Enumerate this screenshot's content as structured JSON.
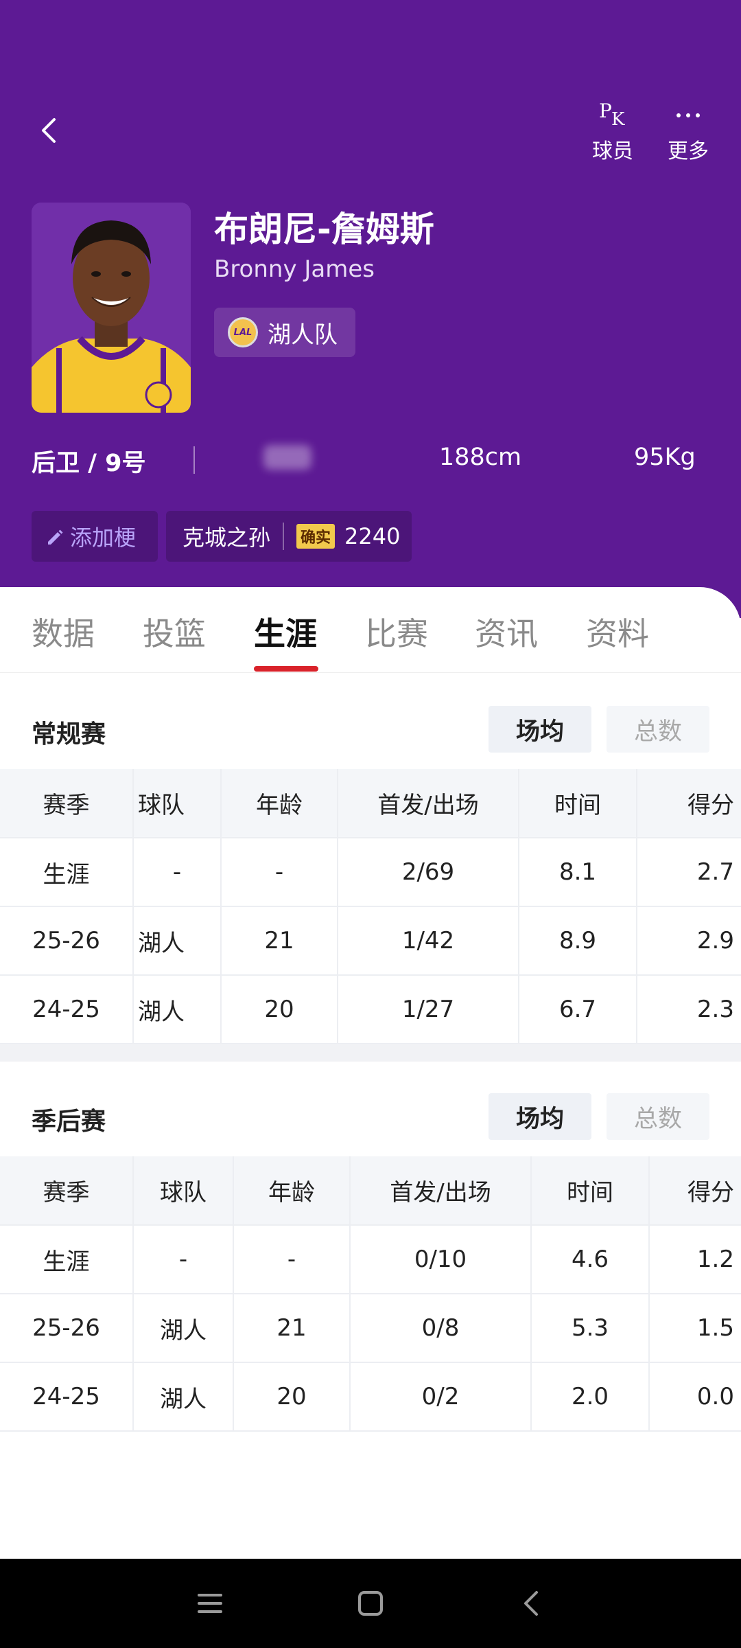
{
  "header": {
    "back_label": "",
    "actions": [
      {
        "icon": "pk-icon",
        "pk_p": "P",
        "pk_k": "K",
        "label": "球员"
      },
      {
        "icon": "more-dots-icon",
        "label": "更多"
      }
    ],
    "player": {
      "name_cn": "布朗尼-詹姆斯",
      "name_en": "Bronny James",
      "team": "湖人队",
      "team_logo_text": "LAL",
      "position_number": "后卫 / 9号",
      "height": "188cm",
      "weight": "95Kg"
    },
    "tags": {
      "add_label": "添加梗",
      "meme": "克城之孙",
      "confirm_badge": "确实",
      "count": "2240"
    }
  },
  "tabs": [
    {
      "label": "数据",
      "active": false
    },
    {
      "label": "投篮",
      "active": false
    },
    {
      "label": "生涯",
      "active": true
    },
    {
      "label": "比赛",
      "active": false
    },
    {
      "label": "资讯",
      "active": false
    },
    {
      "label": "资料",
      "active": false
    }
  ],
  "regular_season": {
    "title": "常规赛",
    "toggle_on": "场均",
    "toggle_off": "总数",
    "columns": [
      "赛季",
      "球队",
      "年龄",
      "首发/出场",
      "时间",
      "得分"
    ],
    "rows": [
      [
        "生涯",
        "-",
        "-",
        "2/69",
        "8.1",
        "2.7"
      ],
      [
        "25-26",
        "湖人",
        "21",
        "1/42",
        "8.9",
        "2.9"
      ],
      [
        "24-25",
        "湖人",
        "20",
        "1/27",
        "6.7",
        "2.3"
      ]
    ]
  },
  "playoffs": {
    "title": "季后赛",
    "toggle_on": "场均",
    "toggle_off": "总数",
    "columns": [
      "赛季",
      "球队",
      "年龄",
      "首发/出场",
      "时间",
      "得分"
    ],
    "rows": [
      [
        "生涯",
        "-",
        "-",
        "0/10",
        "4.6",
        "1.2"
      ],
      [
        "25-26",
        "湖人",
        "21",
        "0/8",
        "5.3",
        "1.5"
      ],
      [
        "24-25",
        "湖人",
        "20",
        "0/2",
        "2.0",
        "0.0"
      ]
    ]
  },
  "colors": {
    "header_bg": "#5d1a94",
    "tab_accent": "#d9222a",
    "confirm_badge": "#f2c94c"
  }
}
